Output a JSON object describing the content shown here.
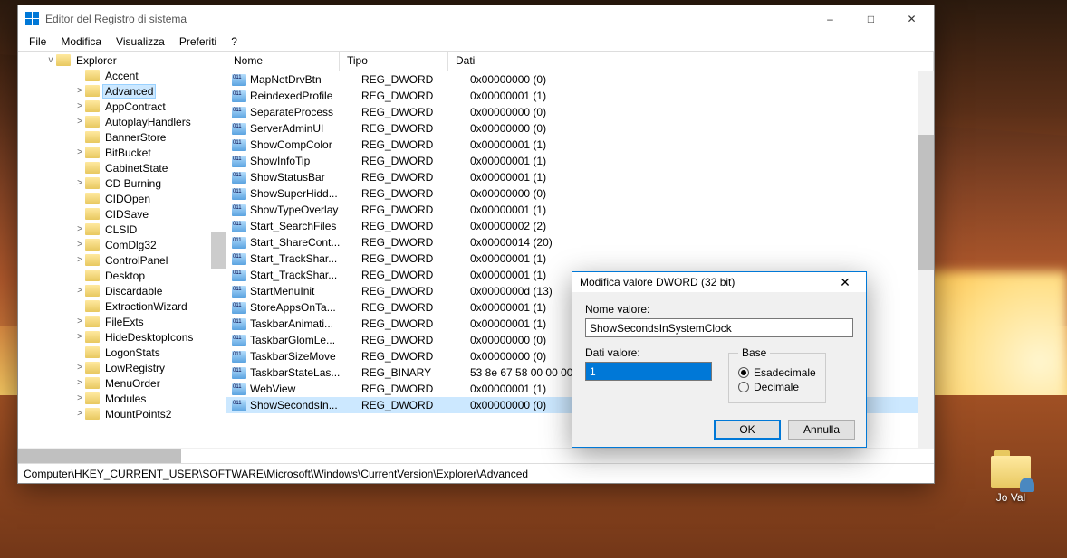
{
  "window": {
    "title": "Editor del Registro di sistema",
    "menu": [
      "File",
      "Modifica",
      "Visualizza",
      "Preferiti",
      "?"
    ],
    "statuspath": "Computer\\HKEY_CURRENT_USER\\SOFTWARE\\Microsoft\\Windows\\CurrentVersion\\Explorer\\Advanced"
  },
  "tree": {
    "root": "Explorer",
    "items": [
      {
        "label": "Accent",
        "exp": ""
      },
      {
        "label": "Advanced",
        "exp": ">",
        "selected": true
      },
      {
        "label": "AppContract",
        "exp": ">"
      },
      {
        "label": "AutoplayHandlers",
        "exp": ">"
      },
      {
        "label": "BannerStore",
        "exp": ""
      },
      {
        "label": "BitBucket",
        "exp": ">"
      },
      {
        "label": "CabinetState",
        "exp": ""
      },
      {
        "label": "CD Burning",
        "exp": ">"
      },
      {
        "label": "CIDOpen",
        "exp": ""
      },
      {
        "label": "CIDSave",
        "exp": ""
      },
      {
        "label": "CLSID",
        "exp": ">"
      },
      {
        "label": "ComDlg32",
        "exp": ">"
      },
      {
        "label": "ControlPanel",
        "exp": ">"
      },
      {
        "label": "Desktop",
        "exp": ""
      },
      {
        "label": "Discardable",
        "exp": ">"
      },
      {
        "label": "ExtractionWizard",
        "exp": ""
      },
      {
        "label": "FileExts",
        "exp": ">"
      },
      {
        "label": "HideDesktopIcons",
        "exp": ">"
      },
      {
        "label": "LogonStats",
        "exp": ""
      },
      {
        "label": "LowRegistry",
        "exp": ">"
      },
      {
        "label": "MenuOrder",
        "exp": ">"
      },
      {
        "label": "Modules",
        "exp": ">"
      },
      {
        "label": "MountPoints2",
        "exp": ">"
      }
    ]
  },
  "list": {
    "headers": {
      "name": "Nome",
      "type": "Tipo",
      "data": "Dati"
    },
    "rows": [
      {
        "name": "MapNetDrvBtn",
        "type": "REG_DWORD",
        "data": "0x00000000 (0)"
      },
      {
        "name": "ReindexedProfile",
        "type": "REG_DWORD",
        "data": "0x00000001 (1)"
      },
      {
        "name": "SeparateProcess",
        "type": "REG_DWORD",
        "data": "0x00000000 (0)"
      },
      {
        "name": "ServerAdminUI",
        "type": "REG_DWORD",
        "data": "0x00000000 (0)"
      },
      {
        "name": "ShowCompColor",
        "type": "REG_DWORD",
        "data": "0x00000001 (1)"
      },
      {
        "name": "ShowInfoTip",
        "type": "REG_DWORD",
        "data": "0x00000001 (1)"
      },
      {
        "name": "ShowStatusBar",
        "type": "REG_DWORD",
        "data": "0x00000001 (1)"
      },
      {
        "name": "ShowSuperHidd...",
        "type": "REG_DWORD",
        "data": "0x00000000 (0)"
      },
      {
        "name": "ShowTypeOverlay",
        "type": "REG_DWORD",
        "data": "0x00000001 (1)"
      },
      {
        "name": "Start_SearchFiles",
        "type": "REG_DWORD",
        "data": "0x00000002 (2)"
      },
      {
        "name": "Start_ShareCont...",
        "type": "REG_DWORD",
        "data": "0x00000014 (20)"
      },
      {
        "name": "Start_TrackShar...",
        "type": "REG_DWORD",
        "data": "0x00000001 (1)"
      },
      {
        "name": "Start_TrackShar...",
        "type": "REG_DWORD",
        "data": "0x00000001 (1)"
      },
      {
        "name": "StartMenuInit",
        "type": "REG_DWORD",
        "data": "0x0000000d (13)"
      },
      {
        "name": "StoreAppsOnTa...",
        "type": "REG_DWORD",
        "data": "0x00000001 (1)"
      },
      {
        "name": "TaskbarAnimati...",
        "type": "REG_DWORD",
        "data": "0x00000001 (1)"
      },
      {
        "name": "TaskbarGlomLe...",
        "type": "REG_DWORD",
        "data": "0x00000000 (0)"
      },
      {
        "name": "TaskbarSizeMove",
        "type": "REG_DWORD",
        "data": "0x00000000 (0)"
      },
      {
        "name": "TaskbarStateLas...",
        "type": "REG_BINARY",
        "data": "53 8e 67 58 00 00 00 00"
      },
      {
        "name": "WebView",
        "type": "REG_DWORD",
        "data": "0x00000001 (1)"
      },
      {
        "name": "ShowSecondsIn...",
        "type": "REG_DWORD",
        "data": "0x00000000 (0)",
        "selected": true
      }
    ]
  },
  "dialog": {
    "title": "Modifica valore DWORD (32 bit)",
    "nameLabel": "Nome valore:",
    "nameValue": "ShowSecondsInSystemClock",
    "dataLabel": "Dati valore:",
    "dataValue": "1",
    "baseLabel": "Base",
    "hex": "Esadecimale",
    "dec": "Decimale",
    "ok": "OK",
    "cancel": "Annulla"
  },
  "desktop": {
    "iconLabel": "Jo Val"
  }
}
